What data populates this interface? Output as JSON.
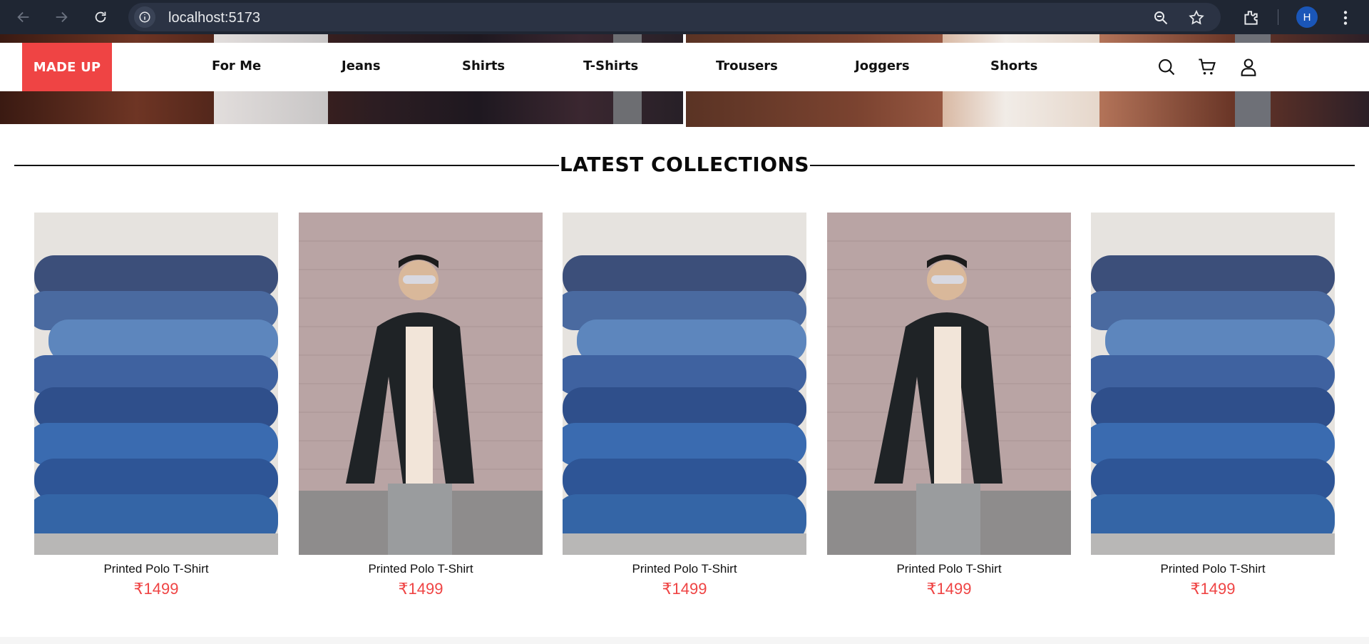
{
  "browser": {
    "url": "localhost:5173",
    "profile_initial": "H"
  },
  "site": {
    "logo": "MADE UP",
    "nav": [
      "For Me",
      "Jeans",
      "Shirts",
      "T-Shirts",
      "Trousers",
      "Joggers",
      "Shorts"
    ]
  },
  "section": {
    "title": "LATEST COLLECTIONS"
  },
  "products": [
    {
      "name": "Printed Polo T-Shirt",
      "price": "₹1499",
      "image": "denim-stack"
    },
    {
      "name": "Printed Polo T-Shirt",
      "price": "₹1499",
      "image": "man-bomber-jacket"
    },
    {
      "name": "Printed Polo T-Shirt",
      "price": "₹1499",
      "image": "denim-stack"
    },
    {
      "name": "Printed Polo T-Shirt",
      "price": "₹1499",
      "image": "man-bomber-jacket"
    },
    {
      "name": "Printed Polo T-Shirt",
      "price": "₹1499",
      "image": "denim-stack"
    }
  ],
  "colors": {
    "accent": "#ef4444",
    "chrome_bg": "#1f2633"
  }
}
